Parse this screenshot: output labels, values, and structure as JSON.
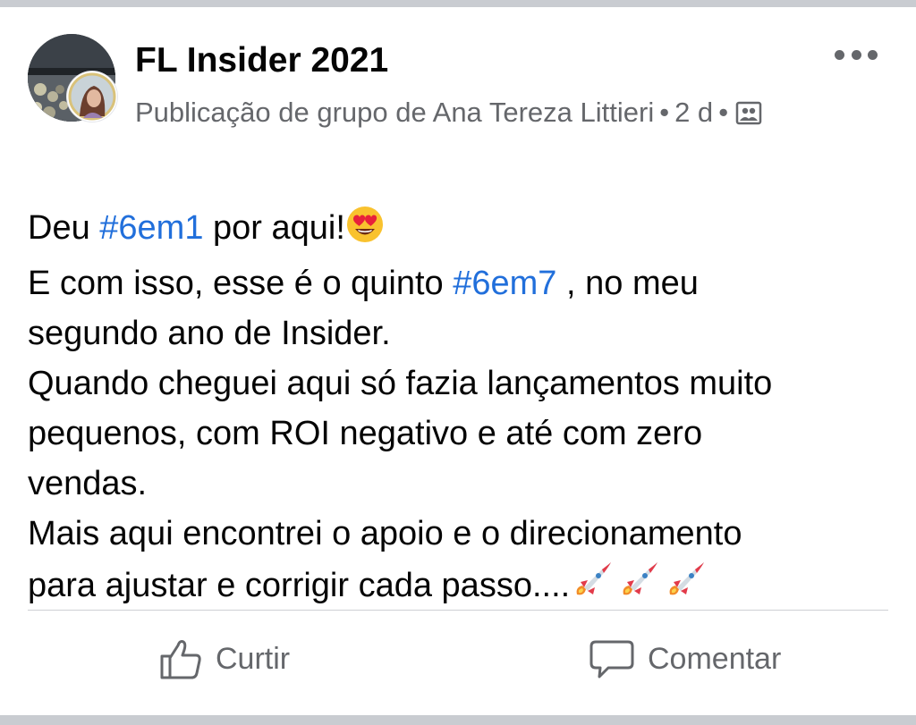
{
  "post": {
    "group_name": "FL Insider 2021",
    "meta_line": "Publicação de grupo de Ana Tereza Littieri",
    "time": "2 d",
    "icons": {
      "more": "more-options-icon",
      "audience": "group-audience-icon"
    },
    "message": {
      "line1_a": "Deu ",
      "line1_hashtag": "#6em1",
      "line1_b": " por aqui!",
      "line1_emoji": "heart-eyes-emoji",
      "line2_a": "E com isso, esse é o quinto ",
      "line2_hashtag": "#6em7",
      "line2_b": " , no meu",
      "line3": "segundo ano de Insider.",
      "line4": "Quando cheguei aqui só fazia lançamentos muito",
      "line5": "pequenos, com ROI negativo e até com zero",
      "line6": "vendas.",
      "line7": "Mais aqui encontrei o apoio e o direcionamento",
      "line8": "para ajustar e corrigir cada passo....",
      "line8_emoji": "rocket-emoji",
      "line8_emoji_count": 3
    },
    "actions": {
      "like_label": "Curtir",
      "comment_label": "Comentar"
    }
  },
  "colors": {
    "hashtag": "#216fdb",
    "secondary_text": "#65676b",
    "divider": "#c9ccd1"
  }
}
